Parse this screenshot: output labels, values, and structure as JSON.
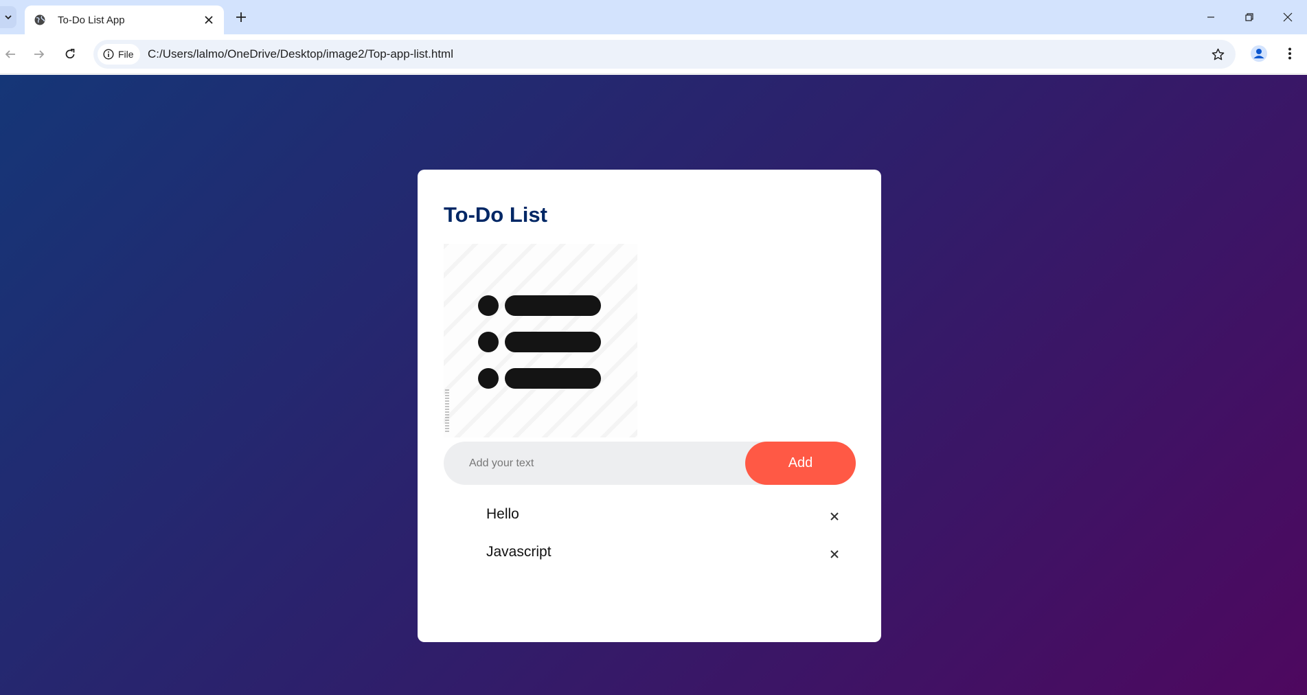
{
  "browser": {
    "tab": {
      "title": "To-Do List App",
      "favicon": "globe-icon"
    },
    "address_bar": {
      "site_chip_label": "File",
      "url": "C:/Users/lalmo/OneDrive/Desktop/image2/Top-app-list.html"
    }
  },
  "app": {
    "title": "To-Do List",
    "input": {
      "placeholder": "Add your text",
      "value": ""
    },
    "add_label": "Add",
    "tasks": [
      {
        "text": "Hello"
      },
      {
        "text": "Javascript"
      }
    ]
  },
  "colors": {
    "accent": "#ff5945",
    "title": "#002765",
    "gradient_start": "#153677",
    "gradient_end": "#4e085f"
  }
}
